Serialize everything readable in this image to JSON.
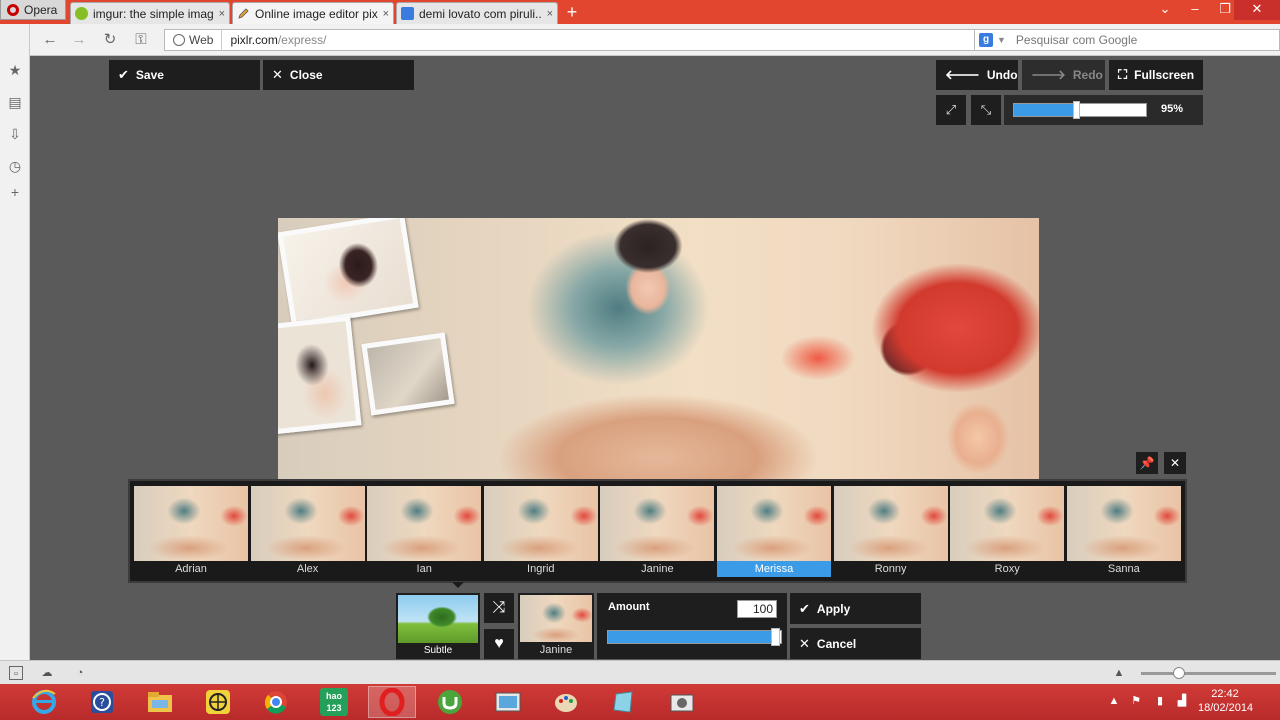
{
  "browser": {
    "menu_label": "Opera",
    "tabs": [
      {
        "label": "imgur: the simple imag...",
        "favicon_color": "#85bf25"
      },
      {
        "label": "Online image editor pix...",
        "favicon_color": "#e6e6e6"
      },
      {
        "label": "demi lovato com piruli...",
        "favicon_color": "#3a7be0"
      }
    ],
    "tab_close_glyph": "×",
    "new_tab_glyph": "+",
    "address": {
      "chip_label": "Web",
      "host": "pixlr.com",
      "path": "/express/"
    },
    "search_placeholder": "Pesquisar com Google",
    "search_engine_glyph": "g"
  },
  "editor": {
    "toolbar": {
      "save_label": "Save",
      "close_label": "Close",
      "undo_label": "Undo",
      "redo_label": "Redo",
      "fullscreen_label": "Fullscreen"
    },
    "zoom": {
      "value_label": "95%",
      "level": 0.47
    },
    "filters": [
      {
        "name": "Adrian"
      },
      {
        "name": "Alex"
      },
      {
        "name": "Ian"
      },
      {
        "name": "Ingrid"
      },
      {
        "name": "Janine"
      },
      {
        "name": "Merissa"
      },
      {
        "name": "Ronny"
      },
      {
        "name": "Roxy"
      },
      {
        "name": "Sanna"
      }
    ],
    "selected_filter": "Merissa",
    "adjust": {
      "preset_label": "Subtle",
      "current_filter_label": "Janine",
      "amount_label": "Amount",
      "amount_value": "100",
      "amount_level": 1.0,
      "apply_label": "Apply",
      "cancel_label": "Cancel"
    }
  },
  "taskbar": {
    "time": "22:42",
    "date": "18/02/2014",
    "hao_label": "hao\n123",
    "accent": "#c43030"
  }
}
